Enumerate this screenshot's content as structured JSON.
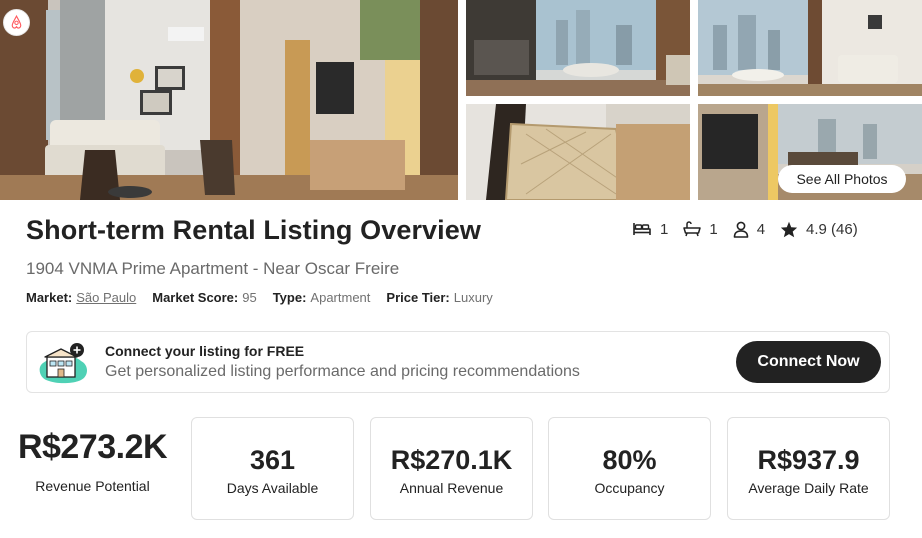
{
  "gallery": {
    "photos": [
      {
        "icon": "living-room-photo"
      },
      {
        "icon": "kitchen-dining-photo"
      },
      {
        "icon": "city-view-living-photo"
      },
      {
        "icon": "rattan-chair-photo"
      },
      {
        "icon": "tv-living-room-photo"
      }
    ],
    "see_all_label": "See All Photos",
    "logo_icon": "airbnb-logo-icon"
  },
  "listing": {
    "title": "Short-term Rental Listing Overview",
    "name": "1904 VNMA Prime Apartment - Near Oscar Freire",
    "specs": {
      "bedrooms": "1",
      "bathrooms": "1",
      "guests": "4",
      "rating": "4.9 (46)"
    },
    "meta": {
      "market_label": "Market:",
      "market_value": "São Paulo",
      "score_label": "Market Score:",
      "score_value": "95",
      "type_label": "Type:",
      "type_value": "Apartment",
      "tier_label": "Price Tier:",
      "tier_value": "Luxury"
    }
  },
  "banner": {
    "title": "Connect your listing for FREE",
    "text": "Get personalized listing performance and pricing recommendations",
    "button_label": "Connect Now",
    "accent_color": "#4fd1b5"
  },
  "stats": {
    "revenue_potential": {
      "value": "R$273.2K",
      "label": "Revenue Potential"
    },
    "cards": [
      {
        "value": "361",
        "label": "Days Available"
      },
      {
        "value": "R$270.1K",
        "label": "Annual Revenue"
      },
      {
        "value": "80%",
        "label": "Occupancy"
      },
      {
        "value": "R$937.9",
        "label": "Average Daily Rate"
      }
    ]
  }
}
